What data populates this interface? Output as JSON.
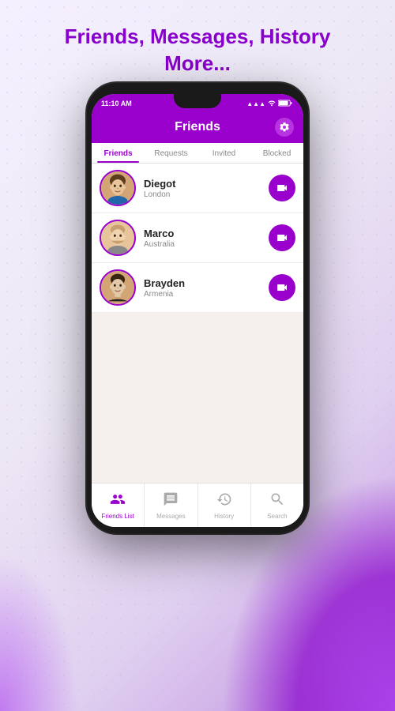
{
  "promo": {
    "title_line1": "Friends, Messages, History",
    "title_line2": "More..."
  },
  "status_bar": {
    "time": "11:10 AM",
    "signal": "▲",
    "wifi": "WiFi",
    "battery": "90"
  },
  "header": {
    "title": "Friends",
    "gear_label": "Settings"
  },
  "tabs": [
    {
      "id": "friends",
      "label": "Friends",
      "active": true
    },
    {
      "id": "requests",
      "label": "Requests",
      "active": false
    },
    {
      "id": "invited",
      "label": "Invited",
      "active": false
    },
    {
      "id": "blocked",
      "label": "Blocked",
      "active": false
    }
  ],
  "friends": [
    {
      "id": 1,
      "name": "Diegot",
      "location": "London",
      "emoji": "👨"
    },
    {
      "id": 2,
      "name": "Marco",
      "location": "Australia",
      "emoji": "🧔"
    },
    {
      "id": 3,
      "name": "Brayden",
      "location": "Armenia",
      "emoji": "👦"
    }
  ],
  "bottom_nav": [
    {
      "id": "friends-list",
      "label": "Friends List",
      "active": true
    },
    {
      "id": "messages",
      "label": "Messages",
      "active": false
    },
    {
      "id": "history",
      "label": "History",
      "active": false
    },
    {
      "id": "search",
      "label": "Search",
      "active": false
    }
  ],
  "colors": {
    "purple": "#9900cc",
    "light_purple": "#b833e0"
  }
}
